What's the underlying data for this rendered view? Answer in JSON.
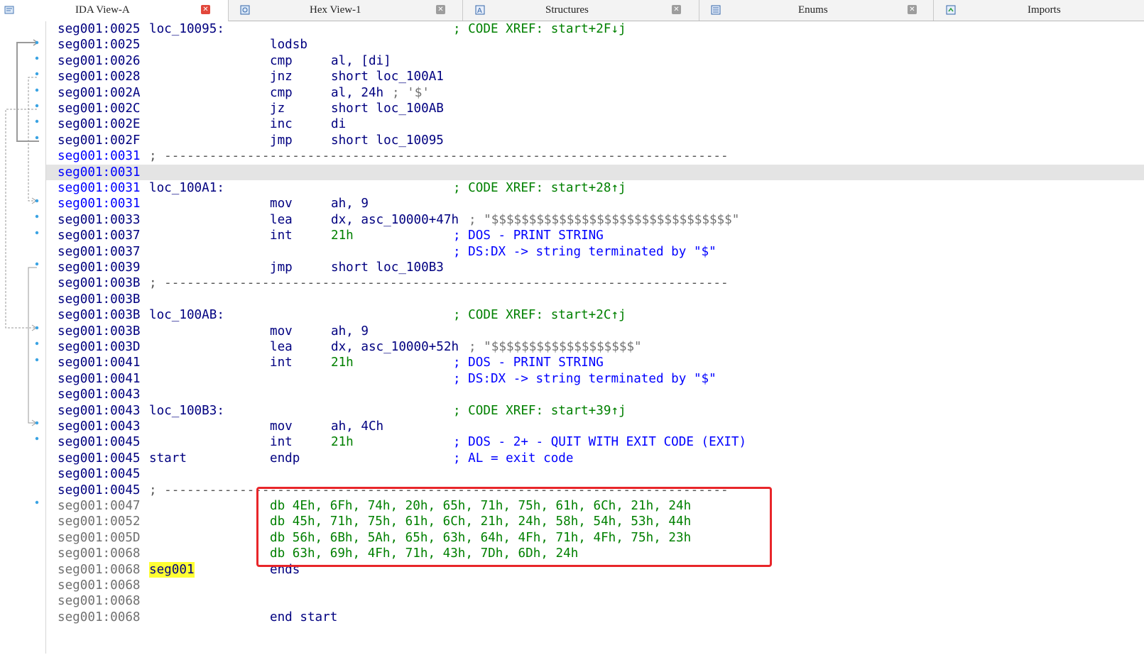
{
  "tabs": [
    {
      "label": "IDA View-A",
      "icon": "ida-view-icon",
      "active": true
    },
    {
      "label": "Hex View-1",
      "icon": "hex-view-icon",
      "active": false
    },
    {
      "label": "Structures",
      "icon": "structures-icon",
      "active": false
    },
    {
      "label": "Enums",
      "icon": "enums-icon",
      "active": false
    },
    {
      "label": "Imports",
      "icon": "imports-icon",
      "active": false
    }
  ],
  "listing": {
    "separator": "; ---------------------------------------------------------------------------",
    "lines": [
      {
        "addr": "seg001:0025",
        "label": "loc_10095:",
        "mnem": "",
        "ops": "",
        "cmt": "; CODE XREF: start+2F↓j"
      },
      {
        "addr": "seg001:0025",
        "label": "",
        "mnem": "lodsb",
        "ops": "",
        "cmt": ""
      },
      {
        "addr": "seg001:0026",
        "label": "",
        "mnem": "cmp",
        "ops": "al, [di]",
        "cmt": ""
      },
      {
        "addr": "seg001:0028",
        "label": "",
        "mnem": "jnz",
        "ops": "short loc_100A1",
        "cmt": ""
      },
      {
        "addr": "seg001:002A",
        "label": "",
        "mnem": "cmp",
        "ops": "al, 24h",
        "ops_comment": "; '$'",
        "cmt": ""
      },
      {
        "addr": "seg001:002C",
        "label": "",
        "mnem": "jz",
        "ops": "short loc_100AB",
        "cmt": ""
      },
      {
        "addr": "seg001:002E",
        "label": "",
        "mnem": "inc",
        "ops": "di",
        "cmt": ""
      },
      {
        "addr": "seg001:002F",
        "label": "",
        "mnem": "jmp",
        "ops": "short loc_10095",
        "cmt": ""
      },
      {
        "addr": "seg001:0031",
        "sep": true
      },
      {
        "addr": "seg001:0031",
        "label": "",
        "mnem": "",
        "ops": "",
        "cmt": ""
      },
      {
        "addr": "seg001:0031",
        "label": "loc_100A1:",
        "mnem": "",
        "ops": "",
        "cmt": "; CODE XREF: start+28↑j"
      },
      {
        "addr": "seg001:0031",
        "label": "",
        "mnem": "mov",
        "ops": "ah, 9",
        "cmt": ""
      },
      {
        "addr": "seg001:0033",
        "label": "",
        "mnem": "lea",
        "ops": "dx, asc_10000+47h",
        "ops_comment": "; \"$$$$$$$$$$$$$$$$$$$$$$$$$$$$$$$$\"",
        "cmt": ""
      },
      {
        "addr": "seg001:0037",
        "label": "",
        "mnem": "int",
        "ops": "21h",
        "cmt": "; DOS - PRINT STRING"
      },
      {
        "addr": "seg001:0037",
        "label": "",
        "mnem": "",
        "ops": "",
        "cmt": "; DS:DX -> string terminated by \"$\""
      },
      {
        "addr": "seg001:0039",
        "label": "",
        "mnem": "jmp",
        "ops": "short loc_100B3",
        "cmt": ""
      },
      {
        "addr": "seg001:003B",
        "sep": true
      },
      {
        "addr": "seg001:003B",
        "label": "",
        "mnem": "",
        "ops": "",
        "cmt": ""
      },
      {
        "addr": "seg001:003B",
        "label": "loc_100AB:",
        "mnem": "",
        "ops": "",
        "cmt": "; CODE XREF: start+2C↑j"
      },
      {
        "addr": "seg001:003B",
        "label": "",
        "mnem": "mov",
        "ops": "ah, 9",
        "cmt": ""
      },
      {
        "addr": "seg001:003D",
        "label": "",
        "mnem": "lea",
        "ops": "dx, asc_10000+52h",
        "ops_comment": "; \"$$$$$$$$$$$$$$$$$$$\"",
        "cmt": ""
      },
      {
        "addr": "seg001:0041",
        "label": "",
        "mnem": "int",
        "ops": "21h",
        "cmt": "; DOS - PRINT STRING"
      },
      {
        "addr": "seg001:0041",
        "label": "",
        "mnem": "",
        "ops": "",
        "cmt": "; DS:DX -> string terminated by \"$\""
      },
      {
        "addr": "seg001:0043",
        "label": "",
        "mnem": "",
        "ops": "",
        "cmt": ""
      },
      {
        "addr": "seg001:0043",
        "label": "loc_100B3:",
        "mnem": "",
        "ops": "",
        "cmt": "; CODE XREF: start+39↑j"
      },
      {
        "addr": "seg001:0043",
        "label": "",
        "mnem": "mov",
        "ops": "ah, 4Ch",
        "cmt": ""
      },
      {
        "addr": "seg001:0045",
        "label": "",
        "mnem": "int",
        "ops": "21h",
        "cmt": "; DOS - 2+ - QUIT WITH EXIT CODE (EXIT)"
      },
      {
        "addr": "seg001:0045",
        "label": "start",
        "mnem": "endp",
        "ops": "",
        "cmt": "; AL = exit code"
      },
      {
        "addr": "seg001:0045",
        "label": "",
        "mnem": "",
        "ops": "",
        "cmt": ""
      },
      {
        "addr": "seg001:0045",
        "sep": true
      },
      {
        "addr": "seg001:0047",
        "data": "db 4Eh, 6Fh, 74h, 20h, 65h, 71h, 75h, 61h, 6Ch, 21h, 24h"
      },
      {
        "addr": "seg001:0052",
        "data": "db 45h, 71h, 75h, 61h, 6Ch, 21h, 24h, 58h, 54h, 53h, 44h"
      },
      {
        "addr": "seg001:005D",
        "data": "db 56h, 6Bh, 5Ah, 65h, 63h, 64h, 4Fh, 71h, 4Fh, 75h, 23h"
      },
      {
        "addr": "seg001:0068",
        "data": "db 63h, 69h, 4Fh, 71h, 43h, 7Dh, 6Dh, 24h"
      },
      {
        "addr": "seg001:0068",
        "label": "seg001",
        "mnem": "ends",
        "ops": "",
        "cmt": ""
      },
      {
        "addr": "seg001:0068",
        "label": "",
        "mnem": "",
        "ops": "",
        "cmt": ""
      },
      {
        "addr": "seg001:0068",
        "label": "",
        "mnem": "",
        "ops": "",
        "cmt": ""
      },
      {
        "addr": "seg001:0068",
        "label": "",
        "mnem": "end start",
        "ops": "",
        "cmt": ""
      }
    ]
  },
  "colors": {
    "address_code": "#000080",
    "address_selected": "#0000ff",
    "address_data": "#707070",
    "comment_xref": "#008000",
    "comment_dos": "#0000ff",
    "numbers": "#008000",
    "highlight_box": "#e8262a",
    "name_highlight": "#ffff33"
  }
}
